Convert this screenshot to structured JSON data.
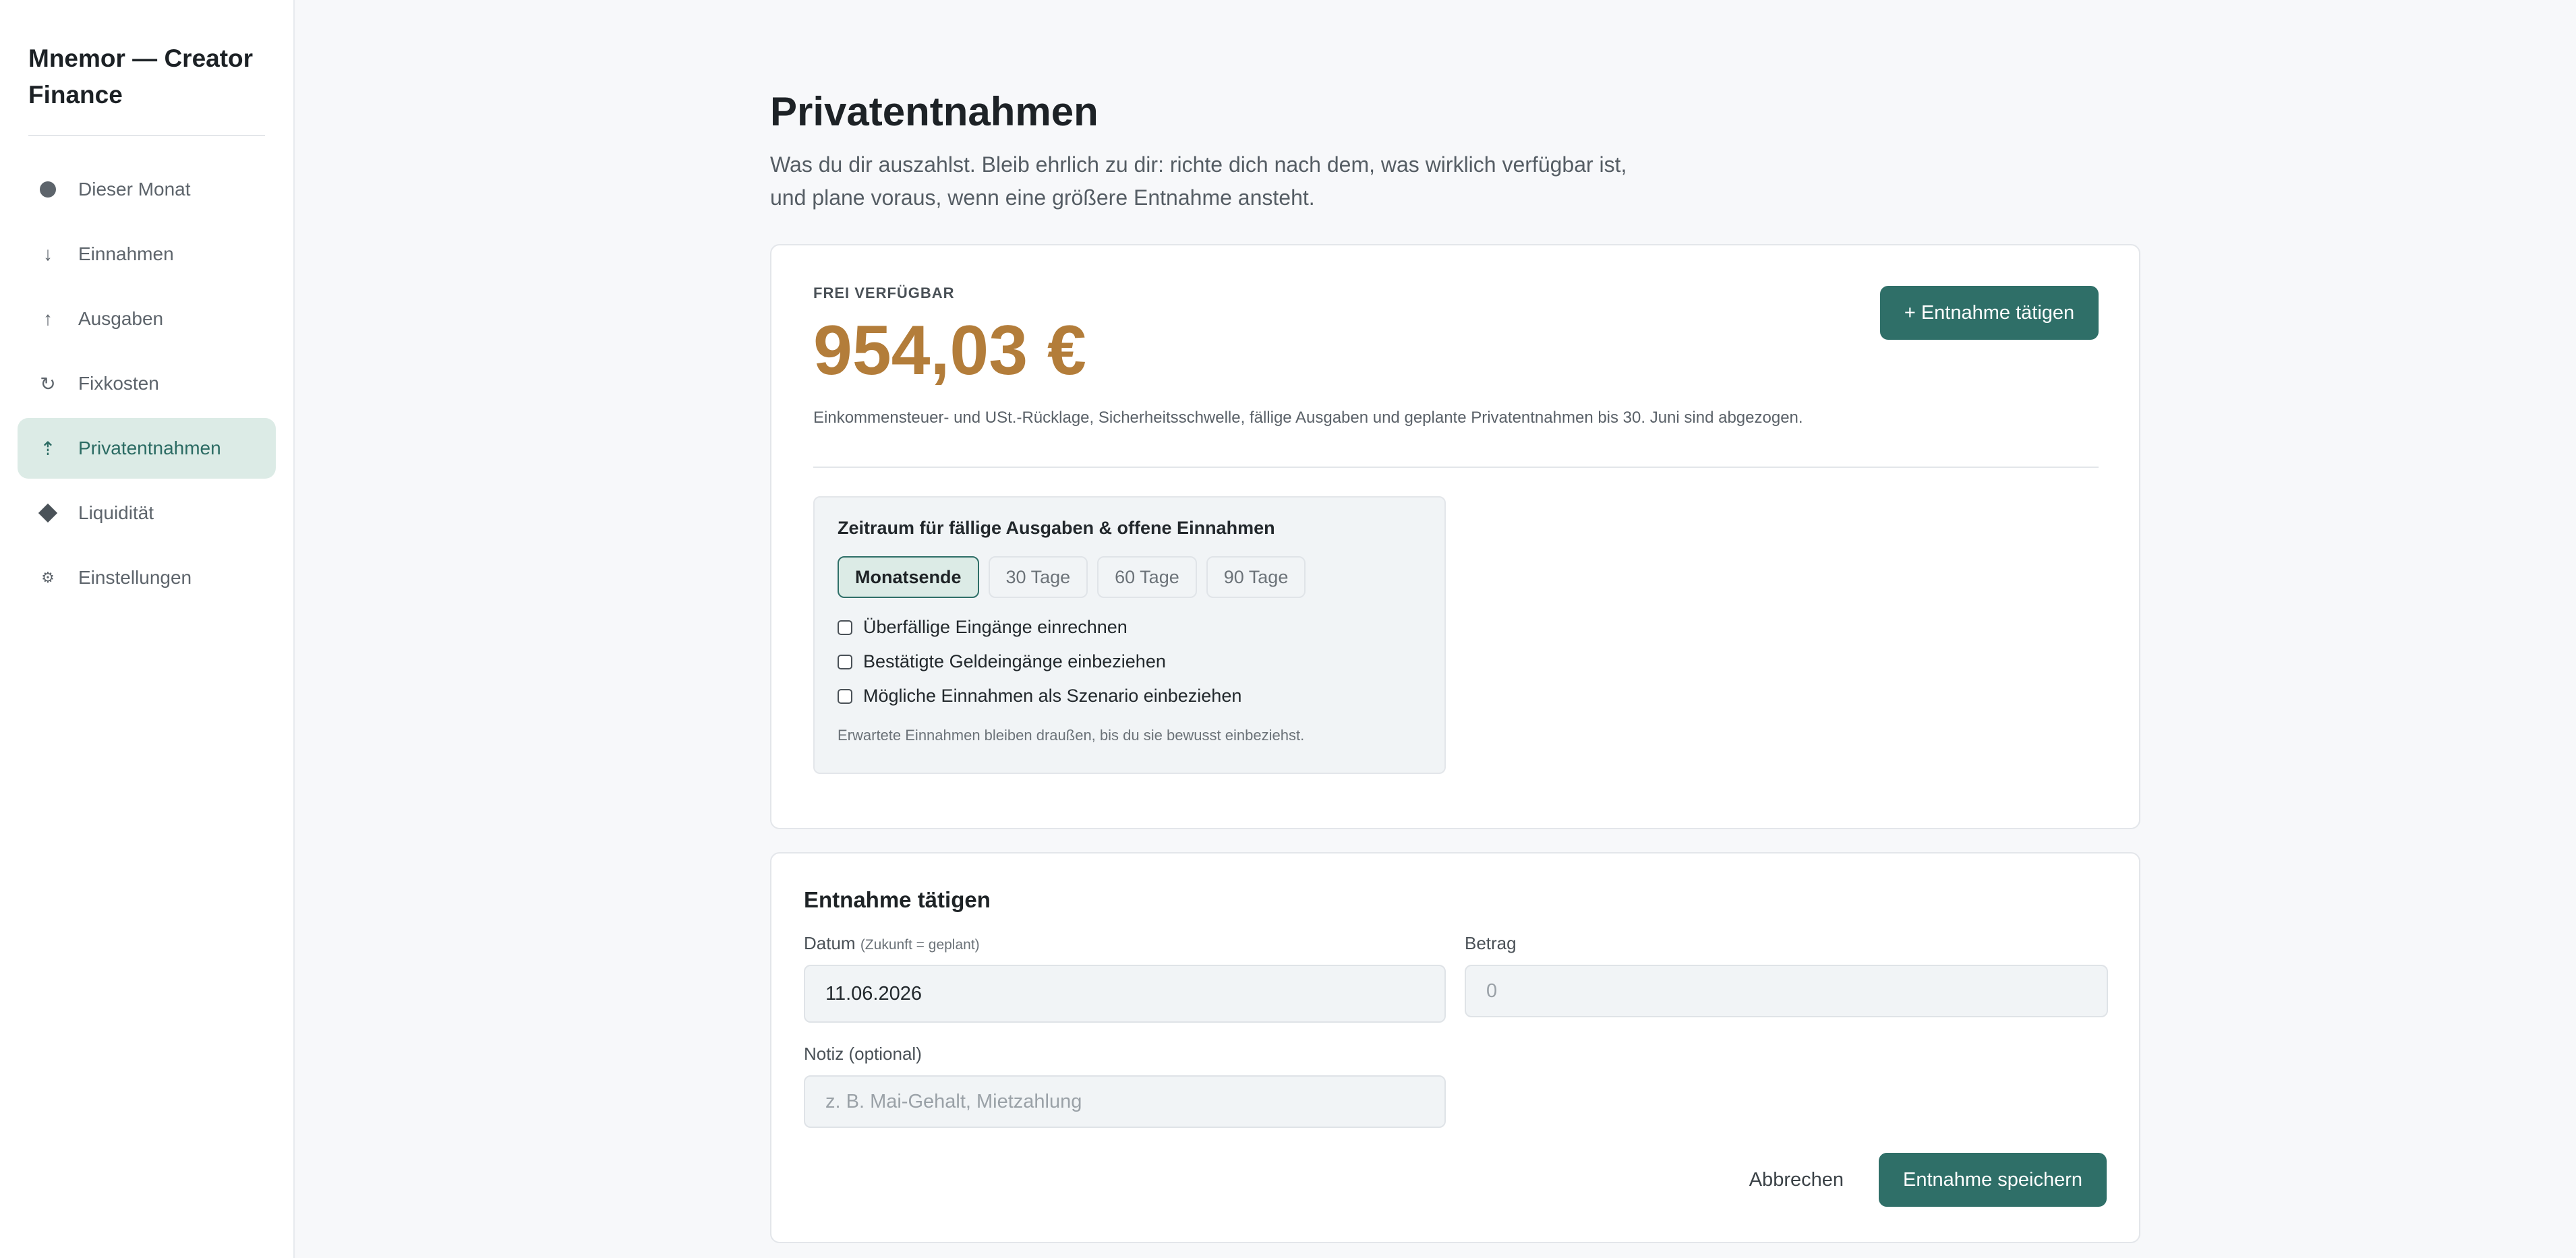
{
  "app": {
    "brand": "Mnemor — Creator Finance"
  },
  "sidebar": {
    "items": [
      {
        "label": "Dieser Monat",
        "icon": "dot-icon",
        "active": false
      },
      {
        "label": "Einnahmen",
        "icon": "arrow-down-icon",
        "active": false
      },
      {
        "label": "Ausgaben",
        "icon": "arrow-up-icon",
        "active": false
      },
      {
        "label": "Fixkosten",
        "icon": "refresh-icon",
        "active": false
      },
      {
        "label": "Privatentnahmen",
        "icon": "withdraw-icon",
        "active": true
      },
      {
        "label": "Liquidität",
        "icon": "diamond-icon",
        "active": false
      },
      {
        "label": "Einstellungen",
        "icon": "gear-icon",
        "active": false
      }
    ]
  },
  "page": {
    "title": "Privatentnahmen",
    "subtitle_line1": "Was du dir auszahlst. Bleib ehrlich zu dir: richte dich nach dem, was wirklich verfügbar ist,",
    "subtitle_line2": "und plane voraus, wenn eine größere Entnahme ansteht."
  },
  "available": {
    "label": "FREI VERFÜGBAR",
    "amount": "954,03 €",
    "note": "Einkommensteuer- und USt.-Rücklage, Sicherheitsschwelle, fällige Ausgaben und geplante Privatentnahmen bis 30. Juni sind abgezogen.",
    "button_label": "+ Entnahme tätigen"
  },
  "filter": {
    "title": "Zeitraum für fällige Ausgaben & offene Einnahmen",
    "periods": [
      "Monatsende",
      "30 Tage",
      "60 Tage",
      "90 Tage"
    ],
    "selected_period": "Monatsende",
    "options": [
      {
        "label": "Überfällige Eingänge einrechnen",
        "checked": false
      },
      {
        "label": "Bestätigte Geldeingänge einbeziehen",
        "checked": false
      },
      {
        "label": "Mögliche Einnahmen als Szenario einbeziehen",
        "checked": false
      }
    ],
    "note": "Erwartete Einnahmen bleiben draußen, bis du sie bewusst einbeziehst."
  },
  "form": {
    "title": "Entnahme tätigen",
    "date_label": "Datum",
    "date_hint": "(Zukunft = geplant)",
    "date_value": "11.06.2026",
    "amount_label": "Betrag",
    "amount_placeholder": "0",
    "note_label": "Notiz (optional)",
    "note_placeholder": "z. B. Mai-Gehalt, Mietzahlung",
    "cancel_label": "Abbrechen",
    "save_label": "Entnahme speichern"
  },
  "colors": {
    "accent": "#2f6f68",
    "amount": "#b37d3a",
    "active_nav_bg": "#dcebe6"
  }
}
